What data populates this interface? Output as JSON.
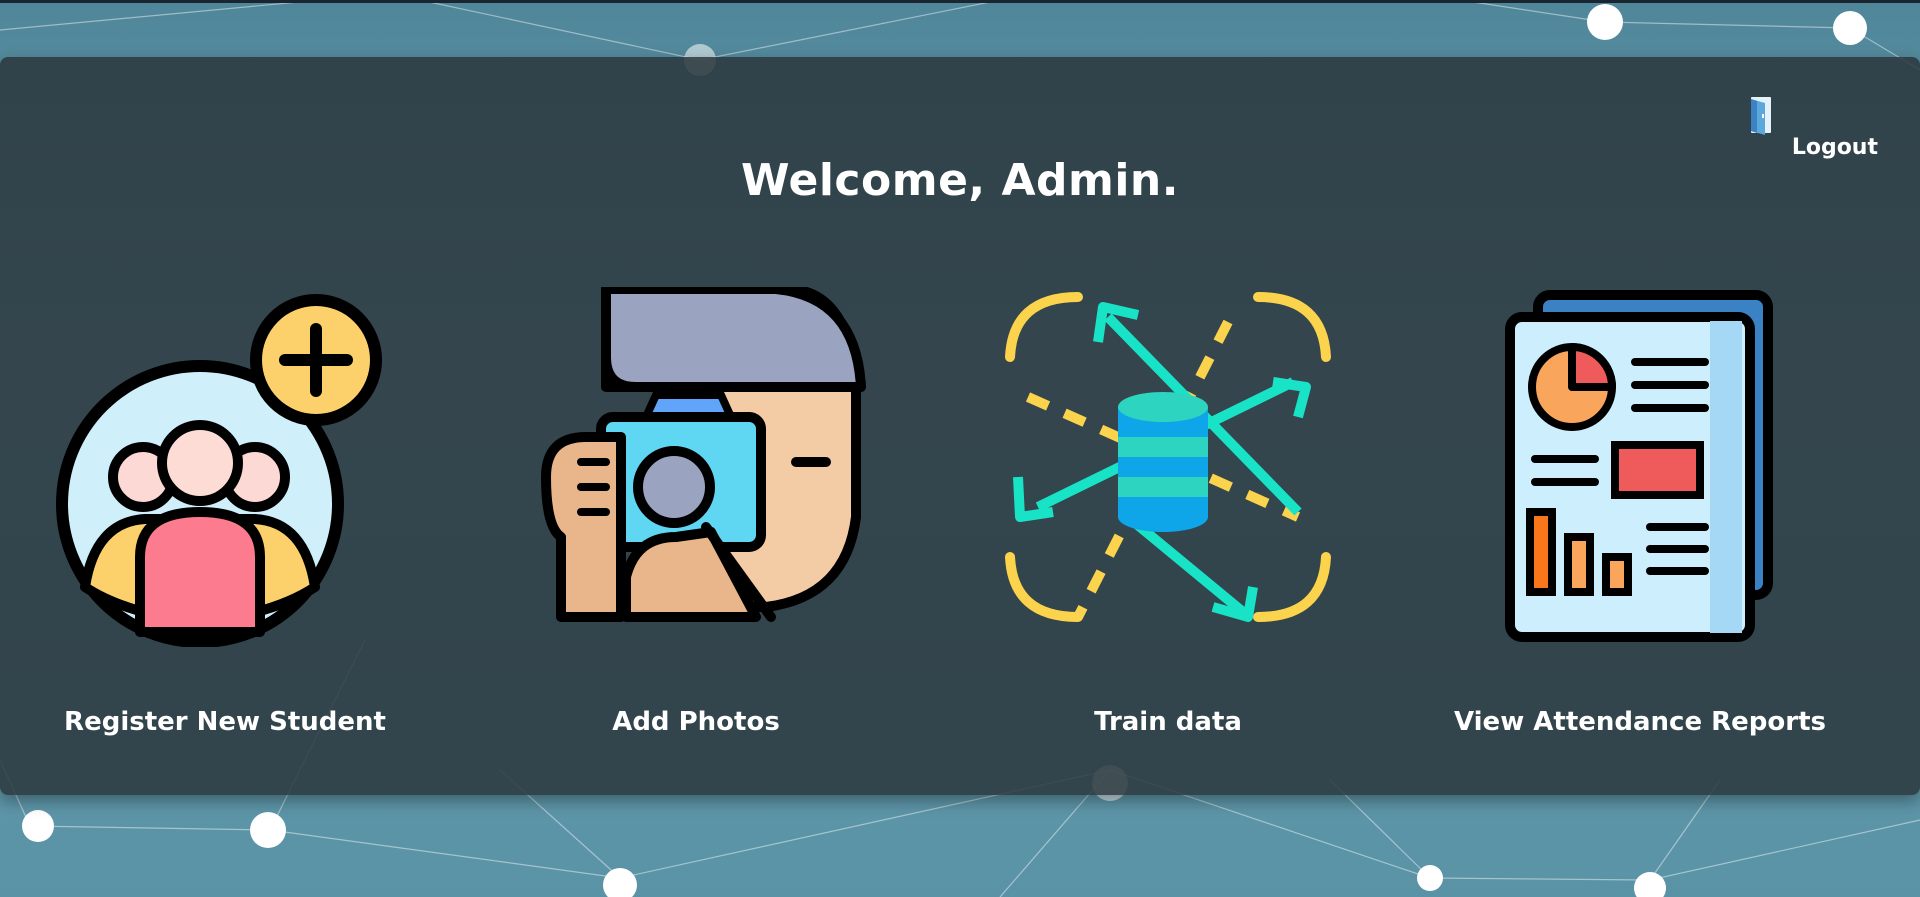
{
  "header": {
    "logout_label": "Logout",
    "logout_icon": "door-icon"
  },
  "main": {
    "welcome": "Welcome, Admin."
  },
  "cards": [
    {
      "label": "Register New Student",
      "icon": "add-students-icon"
    },
    {
      "label": "Add Photos",
      "icon": "photographer-icon"
    },
    {
      "label": "Train data",
      "icon": "train-database-icon"
    },
    {
      "label": "View Attendance Reports",
      "icon": "report-document-icon"
    }
  ],
  "colors": {
    "background": "#5a93a6",
    "panel": "#2b373c",
    "text": "#ffffff",
    "accent_teal": "#18e3c7",
    "accent_yellow": "#fcd34d"
  }
}
